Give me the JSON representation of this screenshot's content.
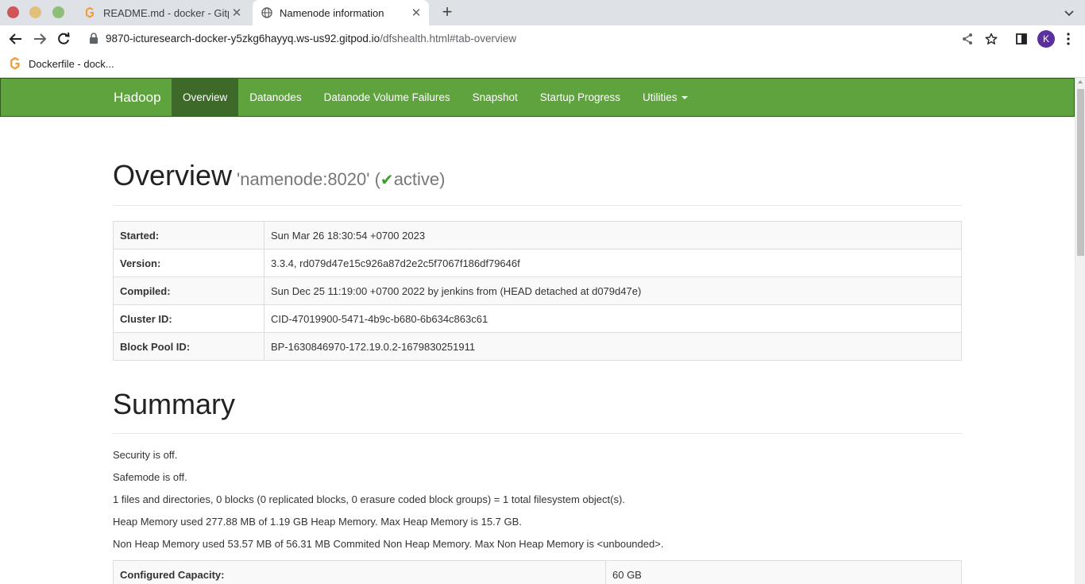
{
  "browser": {
    "tabs": [
      {
        "title": "README.md - docker - Gitpod",
        "active": false
      },
      {
        "title": "Namenode information",
        "active": true
      }
    ],
    "url_host": "9870-icturesearch-docker-y5zkg6hayyq.ws-us92.gitpod.io",
    "url_path": "/dfshealth.html#tab-overview",
    "avatar_letter": "K",
    "bookmark": "Dockerfile - dock...",
    "icons": [
      "back-icon",
      "forward-icon",
      "reload-icon",
      "lock-icon",
      "share-icon",
      "star-icon",
      "side-panel-icon",
      "menu-icon"
    ]
  },
  "navbar": {
    "brand": "Hadoop",
    "items": [
      "Overview",
      "Datanodes",
      "Datanode Volume Failures",
      "Snapshot",
      "Startup Progress",
      "Utilities"
    ],
    "active_index": 0,
    "color": "#5fa33e"
  },
  "overview": {
    "heading": "Overview",
    "namenode": "'namenode:8020'",
    "open_paren": "(",
    "check": "✔",
    "state": "active",
    "close_paren": ")",
    "rows": [
      {
        "key": "Started:",
        "value": "Sun Mar 26 18:30:54 +0700 2023"
      },
      {
        "key": "Version:",
        "value": "3.3.4, rd079d47e15c926a87d2e2c5f7067f186df79646f"
      },
      {
        "key": "Compiled:",
        "value": "Sun Dec 25 11:19:00 +0700 2022 by jenkins from (HEAD detached at d079d47e)"
      },
      {
        "key": "Cluster ID:",
        "value": "CID-47019900-5471-4b9c-b680-6b634c863c61"
      },
      {
        "key": "Block Pool ID:",
        "value": "BP-1630846970-172.19.0.2-1679830251911"
      }
    ]
  },
  "summary": {
    "heading": "Summary",
    "lines": [
      "Security is off.",
      "Safemode is off.",
      "1 files and directories, 0 blocks (0 replicated blocks, 0 erasure coded block groups) = 1 total filesystem object(s).",
      "Heap Memory used 277.88 MB of 1.19 GB Heap Memory. Max Heap Memory is 15.7 GB.",
      "Non Heap Memory used 53.57 MB of 56.31 MB Commited Non Heap Memory. Max Non Heap Memory is <unbounded>."
    ],
    "capacity_key": "Configured Capacity:",
    "capacity_value": "60 GB"
  }
}
